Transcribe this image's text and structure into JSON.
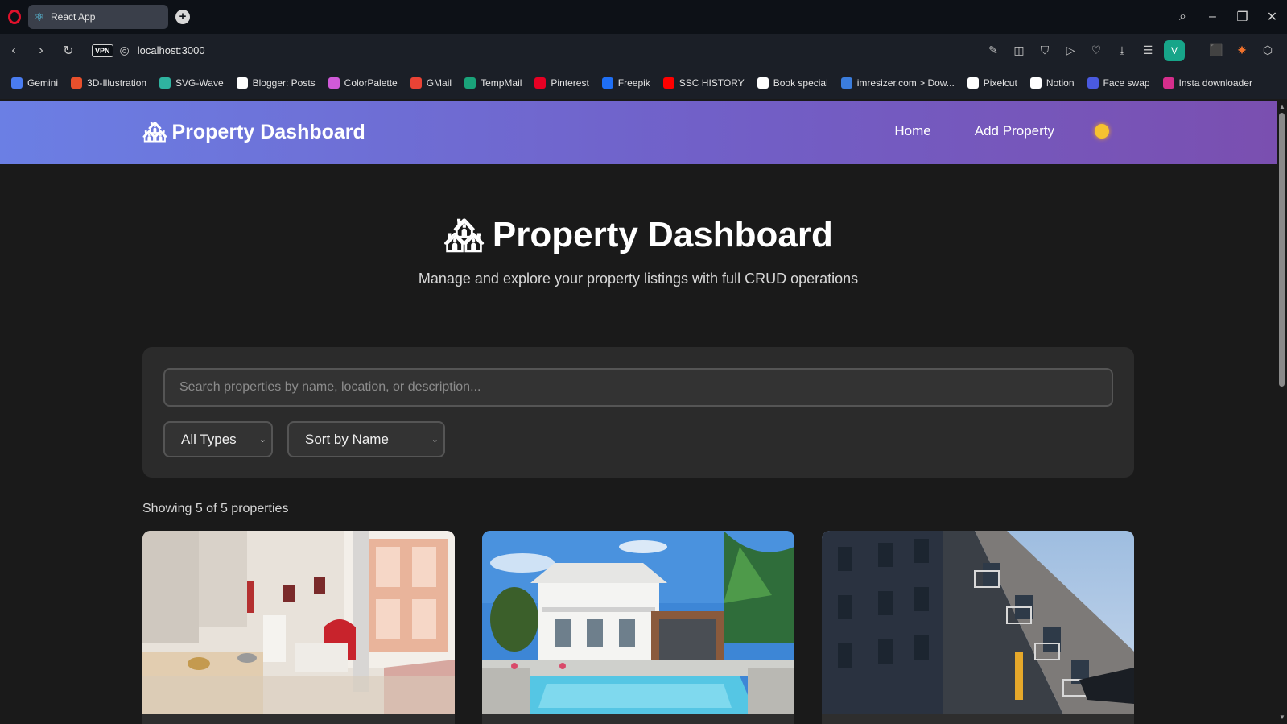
{
  "browser": {
    "tab_title": "React App",
    "url": "localhost:3000",
    "vpn_label": "VPN",
    "profile_initial": "V",
    "bookmarks": [
      {
        "label": "Gemini",
        "icon": "gemini-icon",
        "color": "#4a7cf0"
      },
      {
        "label": "3D-Illustration",
        "icon": "3d-icon",
        "color": "#e8502c"
      },
      {
        "label": "SVG-Wave",
        "icon": "wave-icon",
        "color": "#2fb3a0"
      },
      {
        "label": "Blogger: Posts",
        "icon": "google-icon",
        "color": "#ffffff"
      },
      {
        "label": "ColorPalette",
        "icon": "palette-icon",
        "color": "#d05ad8"
      },
      {
        "label": "GMail",
        "icon": "gmail-icon",
        "color": "#ea4335"
      },
      {
        "label": "TempMail",
        "icon": "tempmail-icon",
        "color": "#1aa37a"
      },
      {
        "label": "Pinterest",
        "icon": "pinterest-icon",
        "color": "#e60023"
      },
      {
        "label": "Freepik",
        "icon": "freepik-icon",
        "color": "#1f6ff5"
      },
      {
        "label": "SSC HISTORY",
        "icon": "youtube-icon",
        "color": "#ff0000"
      },
      {
        "label": "Book special",
        "icon": "amazon-icon",
        "color": "#ffffff"
      },
      {
        "label": "imresizer.com > Dow...",
        "icon": "imresizer-icon",
        "color": "#3b7ddd"
      },
      {
        "label": "Pixelcut",
        "icon": "pixelcut-icon",
        "color": "#ffffff"
      },
      {
        "label": "Notion",
        "icon": "notion-icon",
        "color": "#ffffff"
      },
      {
        "label": "Face swap",
        "icon": "faceswap-icon",
        "color": "#4a5ae0"
      },
      {
        "label": "Insta downloader",
        "icon": "insta-icon",
        "color": "#d62e8c"
      }
    ]
  },
  "header": {
    "brand": "Property Dashboard",
    "nav": [
      {
        "label": "Home"
      },
      {
        "label": "Add Property"
      }
    ],
    "theme_toggle_icon": "sun-icon"
  },
  "hero": {
    "title": "Property Dashboard",
    "subtitle": "Manage and explore your property listings with full CRUD operations"
  },
  "filters": {
    "search_placeholder": "Search properties by name, location, or description...",
    "type_selected": "All Types",
    "sort_selected": "Sort by Name"
  },
  "results": {
    "count_text": "Showing 5 of 5 properties"
  },
  "cards": [
    {
      "image": "apartment-interior-photo"
    },
    {
      "image": "villa-with-pool-photo"
    },
    {
      "image": "modern-apartment-building-photo"
    }
  ],
  "colors": {
    "header_gradient_start": "#6b7fe4",
    "header_gradient_end": "#7a4fb0",
    "page_background": "#1a1a1a",
    "card_background": "#2b2b2b"
  }
}
